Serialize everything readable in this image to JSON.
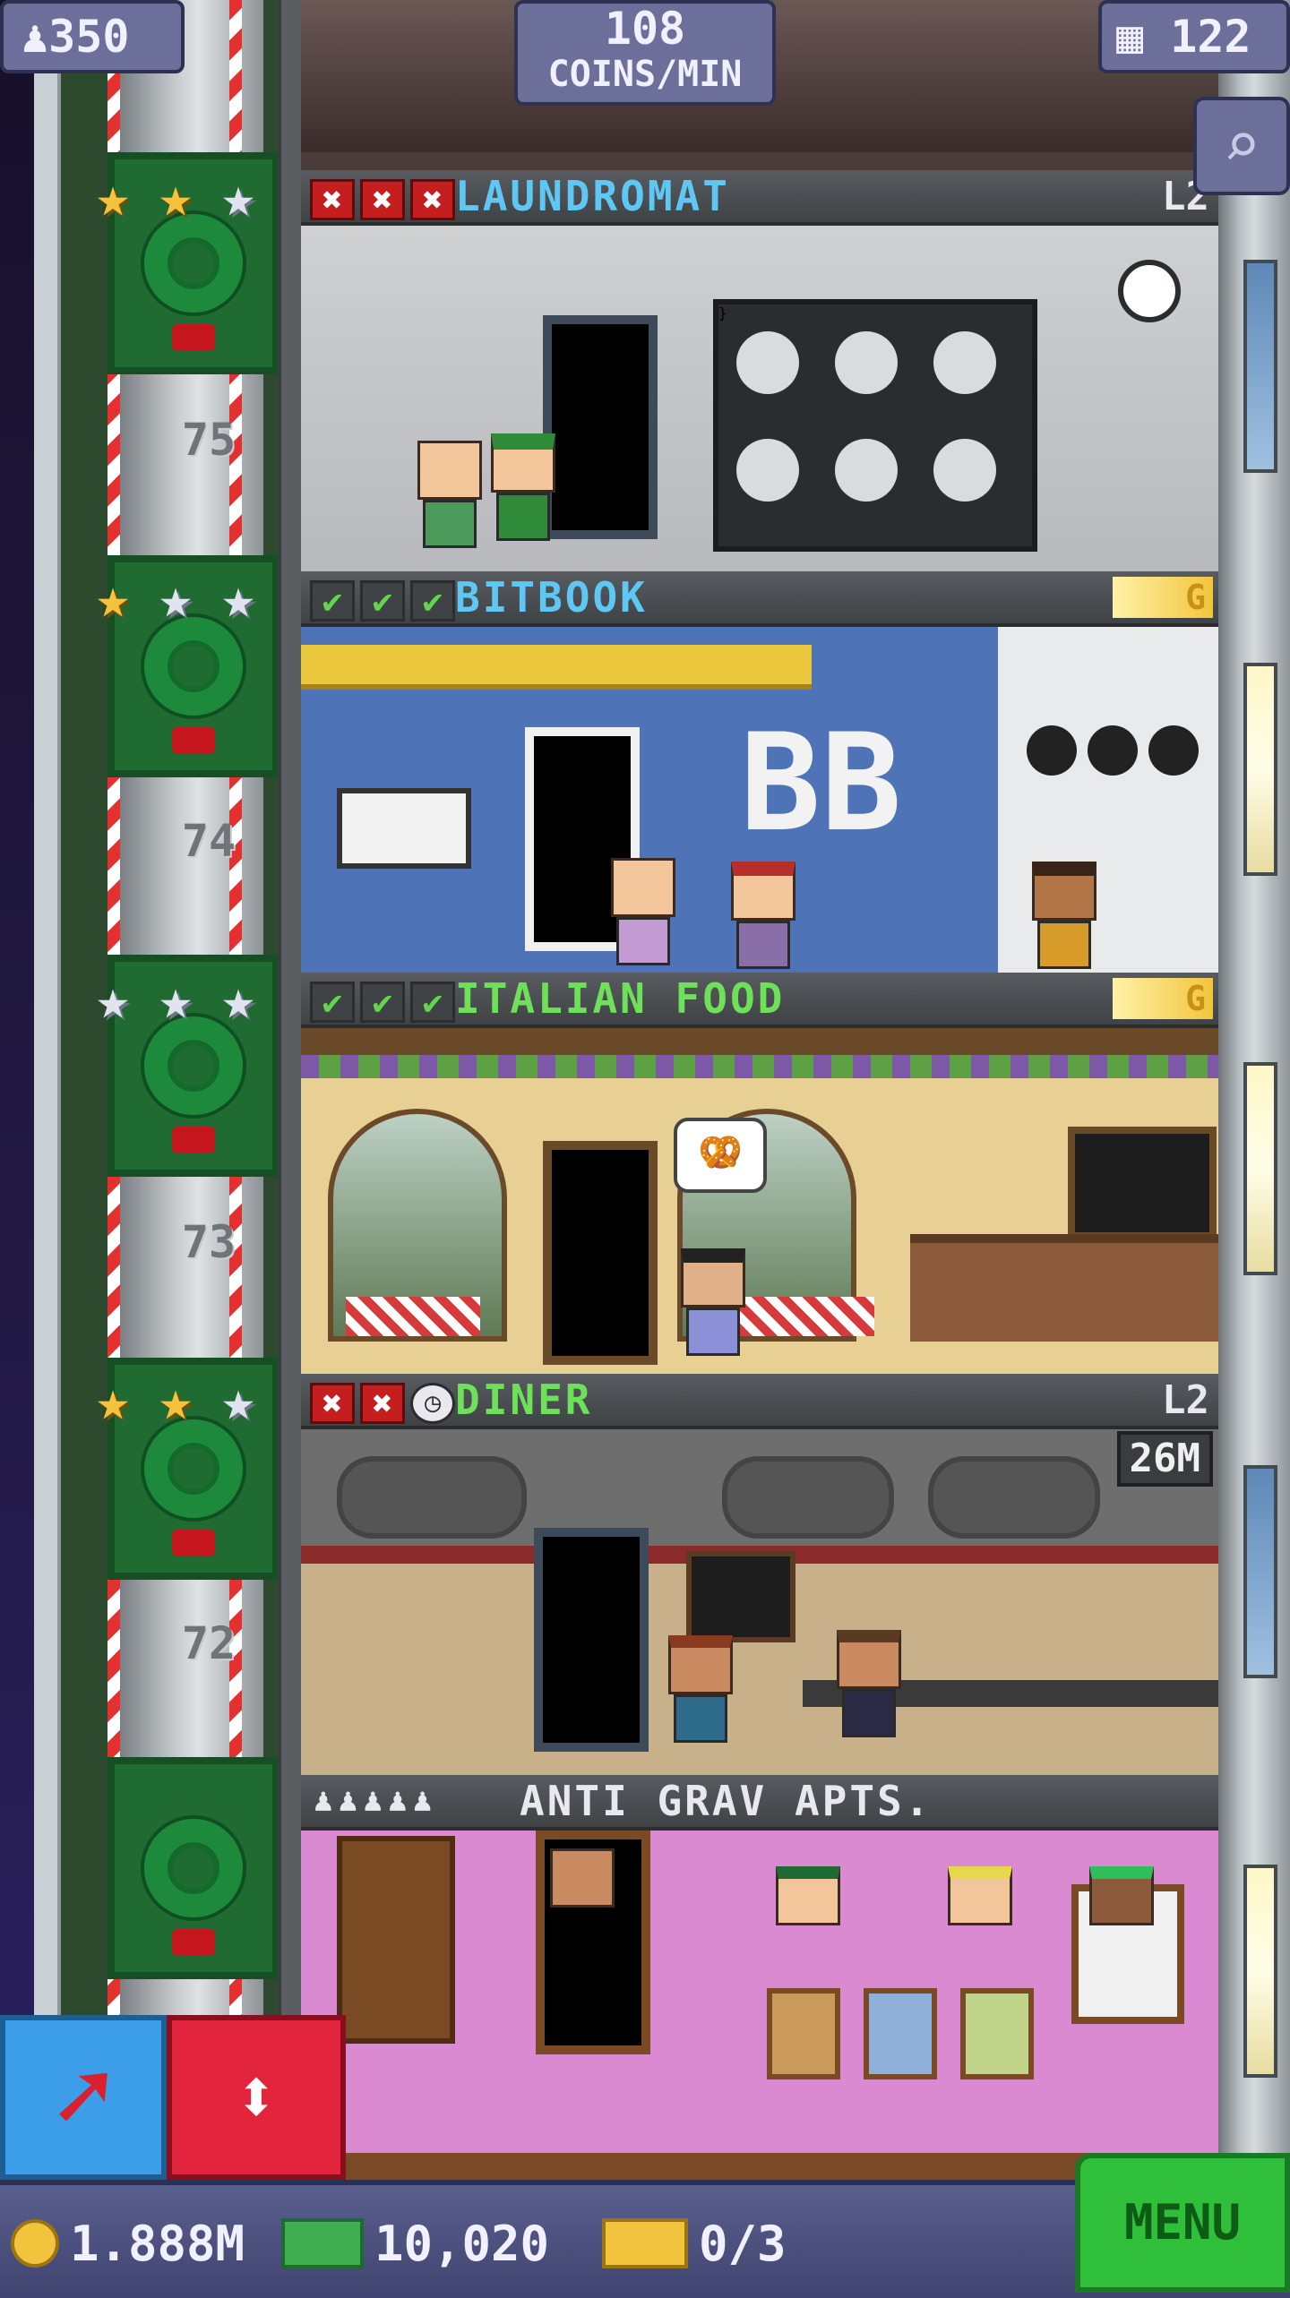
{
  "top_bar": {
    "population": "350",
    "coins_per_min_value": "108",
    "coins_per_min_label": "COINS/MIN",
    "floor_count": "122"
  },
  "shaft": {
    "floor_numbers": [
      "75",
      "74",
      "73",
      "72"
    ]
  },
  "floors": [
    {
      "name": "LAUNDROMAT",
      "level": "L2",
      "status": [
        "x",
        "x",
        "x"
      ],
      "stars": [
        "gold",
        "gold",
        "silver"
      ]
    },
    {
      "name": "BITBOOK",
      "badge": "G",
      "status": [
        "ok",
        "ok",
        "ok"
      ],
      "stars": [
        "gold",
        "silver",
        "silver"
      ],
      "sign": "BB"
    },
    {
      "name": "ITALIAN FOOD",
      "badge": "G",
      "status": [
        "ok",
        "ok",
        "ok"
      ],
      "stars": [
        "silver",
        "silver",
        "silver"
      ]
    },
    {
      "name": "DINER",
      "level": "L2",
      "timer": "26M",
      "status": [
        "x",
        "x",
        "clock"
      ],
      "stars": [
        "gold",
        "gold",
        "silver"
      ]
    },
    {
      "name": "ANTI GRAV APTS.",
      "residents": "♟♟♟♟♟"
    }
  ],
  "bottom_bar": {
    "coins": "1.888M",
    "bux": "10,020",
    "tickets": "0/3",
    "menu_label": "MENU"
  },
  "icons": {
    "move": "arrow-icon",
    "elevator": "elevator-updown-icon",
    "zoom": "magnifier-icon"
  }
}
